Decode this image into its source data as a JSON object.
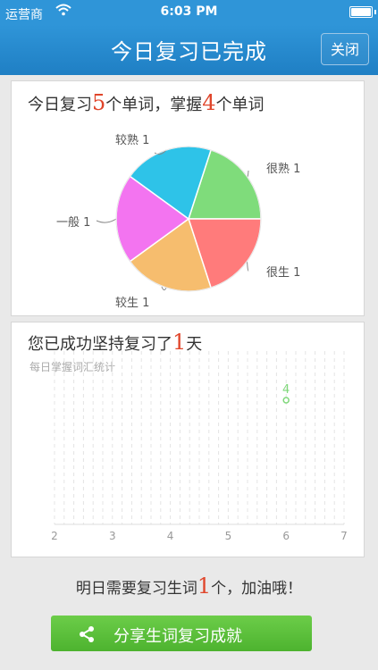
{
  "status": {
    "carrier": "运营商",
    "time": "6:03 PM"
  },
  "nav": {
    "title": "今日复习已完成",
    "close_label": "关闭"
  },
  "review": {
    "prefix": "今日复习",
    "count": "5",
    "mid": "个单词，掌握",
    "mastered": "4",
    "suffix": "个单词"
  },
  "persist": {
    "prefix": "您已成功坚持复习了",
    "days": "1",
    "suffix": "天"
  },
  "footer": {
    "prefix": "明日需要复习生词",
    "count": "1",
    "suffix": "个，加油哦！"
  },
  "share": {
    "label": "分享生词复习成就",
    "icon": "share-icon"
  },
  "chart_data": [
    {
      "type": "pie",
      "slices": [
        {
          "label": "很熟 1",
          "value": 1,
          "color": "#7fdc7b"
        },
        {
          "label": "很生 1",
          "value": 1,
          "color": "#ff7b7b"
        },
        {
          "label": "较生 1",
          "value": 1,
          "color": "#f6bd6e"
        },
        {
          "label": "一般 1",
          "value": 1,
          "color": "#f374f0"
        },
        {
          "label": "较熟 1",
          "value": 1,
          "color": "#2ec3e8"
        }
      ]
    },
    {
      "type": "scatter",
      "title": "每日掌握词汇统计",
      "x_ticks": [
        "2",
        "3",
        "4",
        "5",
        "6",
        "7"
      ],
      "xlim": [
        2,
        7
      ],
      "points": [
        {
          "x": 6,
          "y": 4,
          "label": "4"
        }
      ],
      "point_color": "#7fd87a",
      "grid": true
    }
  ]
}
